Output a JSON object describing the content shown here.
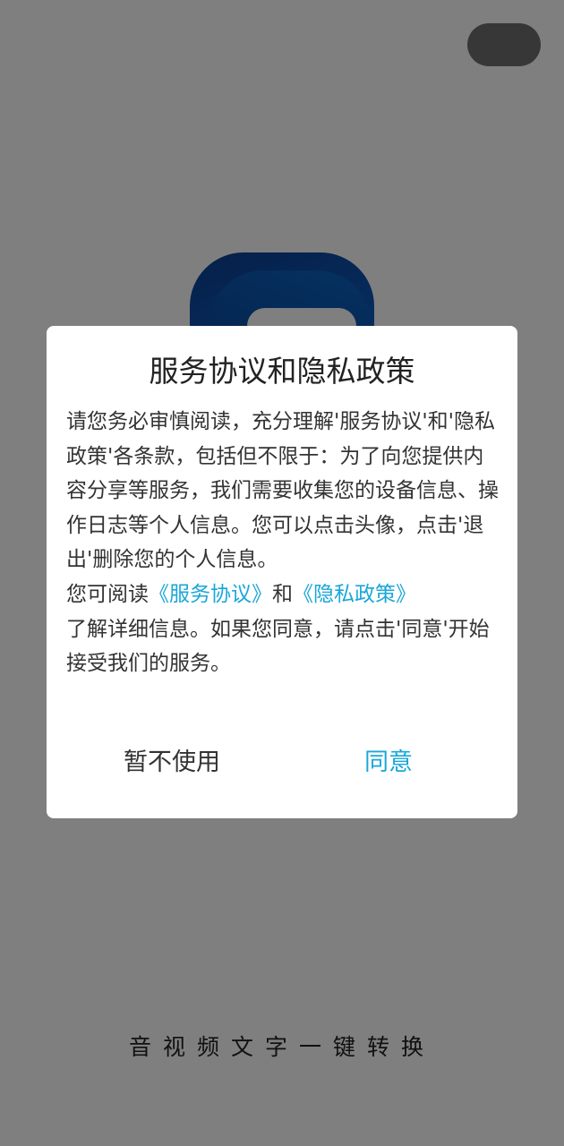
{
  "splash": {
    "slogan": "音视频文字一键转换"
  },
  "dialog": {
    "title": "服务协议和隐私政策",
    "paragraph1": "请您务必审慎阅读，充分理解'服务协议'和'隐私政策'各条款，包括但不限于：为了向您提供内容分享等服务，我们需要收集您的设备信息、操作日志等个人信息。您可以点击头像，点击'退出'删除您的个人信息。",
    "paragraph2_prefix": "您可阅读",
    "service_link": "《服务协议》",
    "and": "和",
    "privacy_link": "《隐私政策》",
    "paragraph2_suffix": "了解详细信息。如果您同意，请点击'同意'开始接受我们的服务。",
    "cancel_label": "暂不使用",
    "agree_label": "同意"
  },
  "colors": {
    "accent": "#19a7d9",
    "logo_blue": "#0c58b8"
  }
}
